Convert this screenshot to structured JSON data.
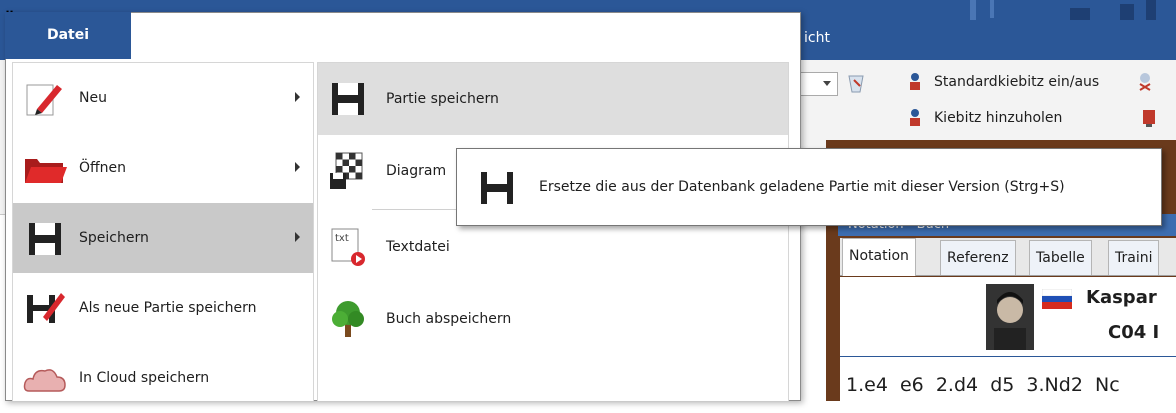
{
  "window": {
    "quote_mark": "„"
  },
  "file_menu": {
    "tab_label": "Datei",
    "items": [
      {
        "label": "Neu",
        "icon": "new-pencil-icon",
        "submenu": true
      },
      {
        "label": "Öffnen",
        "icon": "folder-open-icon",
        "submenu": true
      },
      {
        "label": "Speichern",
        "icon": "floppy-disk-icon",
        "submenu": true,
        "highlighted": true
      },
      {
        "label": "Als neue Partie speichern",
        "icon": "save-as-icon",
        "submenu": false
      },
      {
        "label": "In Cloud speichern",
        "icon": "cloud-icon",
        "submenu": false
      }
    ],
    "submenu_items": [
      {
        "label": "Partie speichern",
        "icon": "floppy-disk-icon",
        "highlighted": true
      },
      {
        "label": "Diagram",
        "icon": "chessboard-diagram-icon"
      },
      {
        "label": "Textdatei",
        "icon": "text-file-icon",
        "icon_text": "txt"
      },
      {
        "label": "Buch abspeichern",
        "icon": "tree-icon"
      }
    ]
  },
  "tooltip": {
    "text": "Ersetze die aus der Datenbank geladene Partie mit dieser Version (Strg+S)",
    "icon": "floppy-disk-icon"
  },
  "ribbon": {
    "tab_partial": "icht",
    "items": [
      {
        "label": "Standardkiebitz ein/aus",
        "icon": "kibitz-icon"
      },
      {
        "label": "Kiebitz hinzuholen",
        "icon": "kibitz-icon"
      }
    ]
  },
  "notation_panel": {
    "header": "Notation - Buch",
    "tabs": [
      "Notation",
      "Referenz",
      "Tabelle",
      "Traini"
    ],
    "active_tab": "Notation",
    "player_name": "Kaspar",
    "eco": "C04 I",
    "moves": "1.e4  e6  2.d4  d5  3.Nd2  Nc"
  },
  "colors": {
    "accent": "#2b5797",
    "highlight": "#c9c9c9",
    "submenu_highlight": "#dedede"
  }
}
